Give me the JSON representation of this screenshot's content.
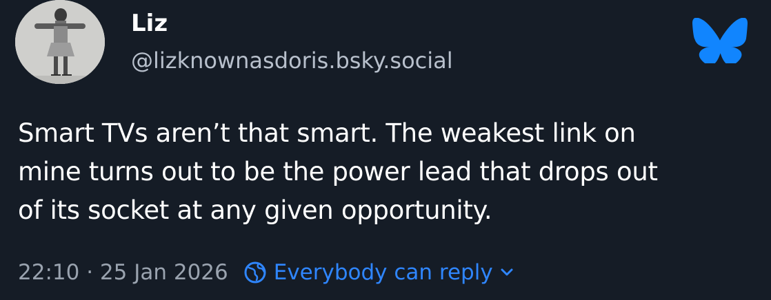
{
  "author": {
    "display_name": "Liz",
    "handle": "@lizknownasdoris.bsky.social"
  },
  "post": {
    "text_lines": [
      "Smart TVs aren’t that smart. The weakest link on",
      "mine turns out to be the power lead that drops out",
      "of its socket at any given opportunity."
    ],
    "timestamp": "22:10 · 25 Jan 2026",
    "reply_setting": "Everybody can reply"
  },
  "icons": {
    "brand": "butterfly-icon",
    "reply": "earth-icon",
    "dropdown": "chevron-down-icon"
  },
  "colors": {
    "background": "#151c26",
    "text": "#ffffff",
    "secondary_text": "#b8c0cc",
    "accent": "#2f86ff",
    "brand": "#1185fe"
  }
}
